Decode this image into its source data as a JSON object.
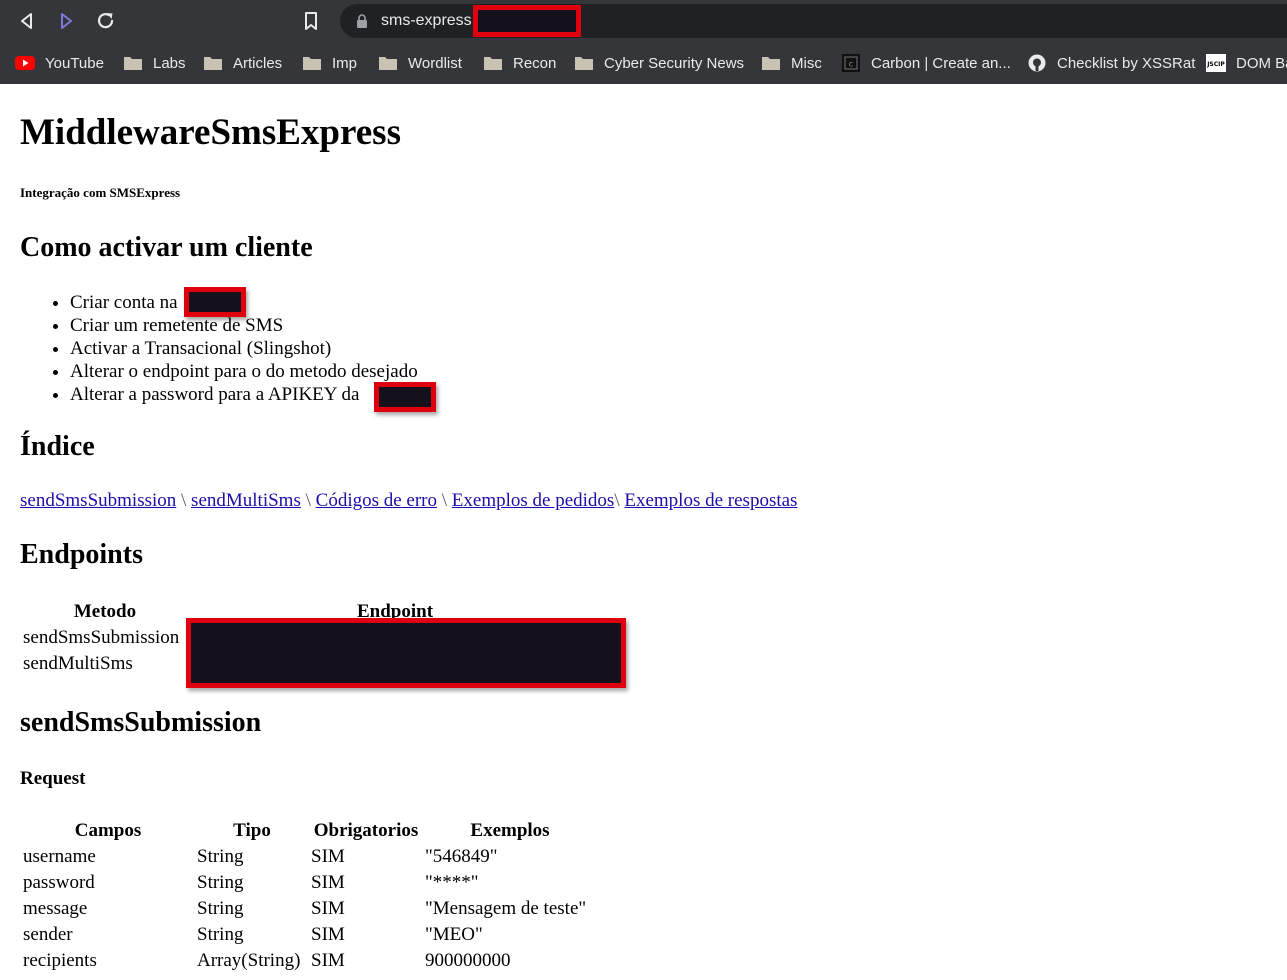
{
  "browser": {
    "url": "sms-express",
    "bookmarks": [
      {
        "label": "YouTube",
        "icon": "youtube-icon"
      },
      {
        "label": "Labs",
        "icon": "folder-icon"
      },
      {
        "label": "Articles",
        "icon": "folder-icon"
      },
      {
        "label": "Imp",
        "icon": "folder-icon"
      },
      {
        "label": "Wordlist",
        "icon": "folder-icon"
      },
      {
        "label": "Recon",
        "icon": "folder-icon"
      },
      {
        "label": "Cyber Security News",
        "icon": "folder-icon"
      },
      {
        "label": "Misc",
        "icon": "folder-icon"
      },
      {
        "label": "Carbon | Create an...",
        "icon": "carbon-icon"
      },
      {
        "label": "Checklist by XSSRat",
        "icon": "github-icon"
      },
      {
        "label": "DOM Ba",
        "icon": "jscip-icon"
      }
    ]
  },
  "page": {
    "title": "MiddlewareSmsExpress",
    "subtitle": "Integração com SMSExpress",
    "activate": {
      "heading": "Como activar um cliente",
      "steps": [
        "Criar conta na",
        "Criar um remetente de SMS",
        "Activar a Transacional (Slingshot)",
        "Alterar o endpoint para o do metodo desejado",
        "Alterar a password para a APIKEY da"
      ]
    },
    "index": {
      "heading": "Índice",
      "links": [
        "sendSmsSubmission",
        "sendMultiSms",
        "Códigos de erro",
        "Exemplos de pedidos",
        "Exemplos de respostas"
      ],
      "separator": "\\"
    },
    "endpoints": {
      "heading": "Endpoints",
      "columns": [
        "Metodo",
        "Endpoint"
      ],
      "rows": [
        "sendSmsSubmission",
        "sendMultiSms"
      ]
    },
    "submission": {
      "heading": "sendSmsSubmission",
      "request_heading": "Request",
      "columns": [
        "Campos",
        "Tipo",
        "Obrigatorios",
        "Exemplos"
      ],
      "rows": [
        [
          "username",
          "String",
          "SIM",
          "\"546849\""
        ],
        [
          "password",
          "String",
          "SIM",
          "\"****\""
        ],
        [
          "message",
          "String",
          "SIM",
          "\"Mensagem de teste\""
        ],
        [
          "sender",
          "String",
          "SIM",
          "\"MEO\""
        ],
        [
          "recipients",
          "Array(String)",
          "SIM",
          "900000000"
        ]
      ]
    }
  },
  "colors": {
    "chrome": "#35363a",
    "omnibox": "#202124",
    "redaction_fill": "#14111c",
    "redaction_border": "#e0000d",
    "link": "#1a0dab"
  }
}
